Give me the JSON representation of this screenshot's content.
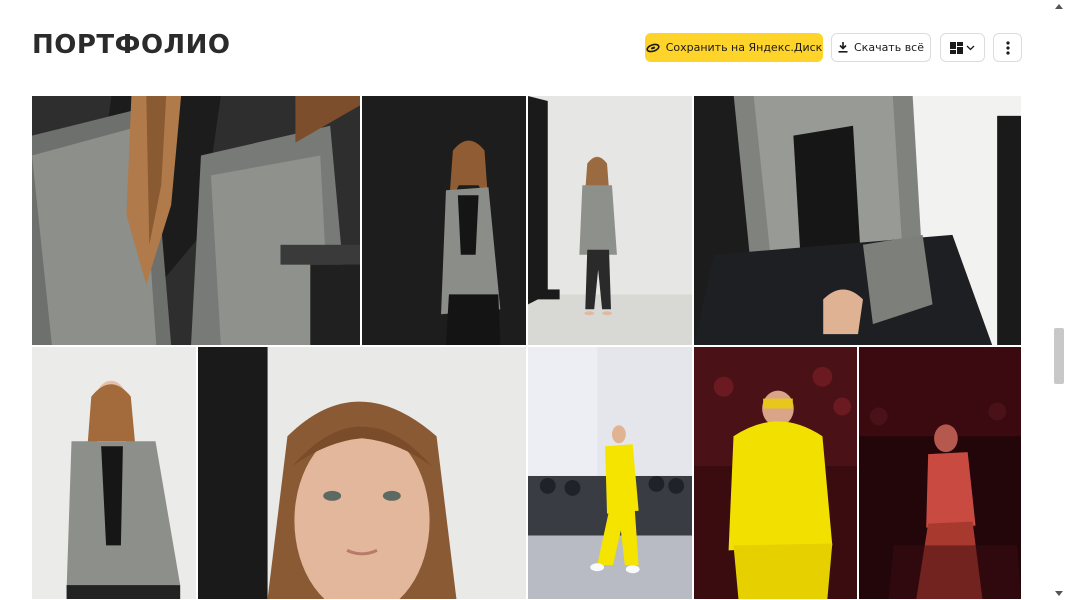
{
  "header": {
    "title": "ПОРТФОЛИО"
  },
  "toolbar": {
    "save_label": "Сохранить на Яндекс.Диск",
    "download_label": "Скачать всё",
    "accent_color": "#fed42b"
  },
  "gallery": {
    "photos": [
      {
        "name": "photo-plaid-blazer-closeup"
      },
      {
        "name": "photo-girl-black-backdrop"
      },
      {
        "name": "photo-girl-white-studio-full"
      },
      {
        "name": "photo-hand-on-knee-closeup"
      },
      {
        "name": "photo-girl-blazer-portrait"
      },
      {
        "name": "photo-face-closeup"
      },
      {
        "name": "photo-yellow-suit-runway"
      },
      {
        "name": "photo-yellow-hoodie-red-light"
      },
      {
        "name": "photo-dancer-red-light"
      }
    ]
  }
}
